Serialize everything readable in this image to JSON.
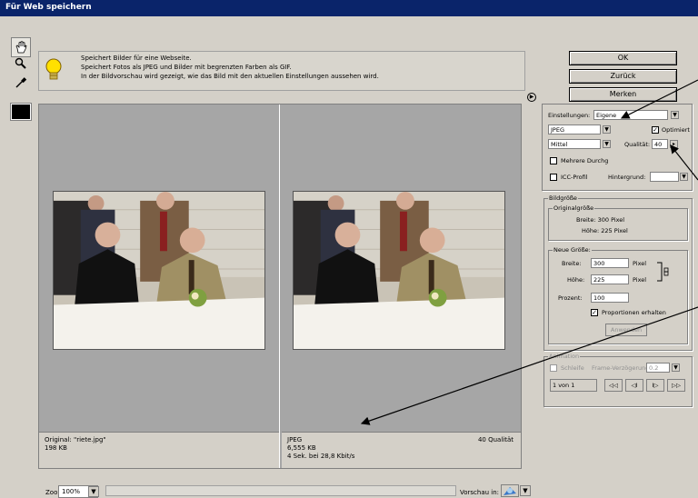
{
  "window": {
    "title": "Für Web speichern"
  },
  "info": {
    "lines": [
      "Speichert Bilder für eine Webseite.",
      "Speichert Fotos als JPEG und Bilder mit begrenzten Farben als GIF.",
      "In der Bildvorschau wird gezeigt, wie das Bild mit den aktuellen Einstellungen aussehen wird."
    ]
  },
  "preview": {
    "original": {
      "label": "Original: \"riete.jpg\"",
      "size": "198 KB"
    },
    "optimized": {
      "format": "JPEG",
      "size": "6,555 KB",
      "time": "4 Sek. bei 28,8 Kbit/s",
      "quality": "40 Qualität"
    }
  },
  "bottom": {
    "zoom_label": "Zoom:",
    "zoom_value": "100%",
    "preview_in_label": "Vorschau in:"
  },
  "buttons": {
    "ok": "OK",
    "back": "Zurück",
    "remember": "Merken"
  },
  "settings": {
    "label": "Einstellungen:",
    "preset": "Eigene",
    "format": "JPEG",
    "optimized_label": "Optimiert",
    "quality_level": "Mittel",
    "quality_label": "Qualität:",
    "quality_value": "40",
    "progressive_label": "Mehrere Durchg",
    "icc_label": "ICC-Profil",
    "matte_label": "Hintergrund:"
  },
  "image_size": {
    "title": "Bildgröße",
    "original_title": "Originalgröße",
    "orig_width": "Breite: 300 Pixel",
    "orig_height": "Höhe: 225 Pixel",
    "new_title": "Neue Größe:",
    "width_label": "Breite:",
    "width_value": "300",
    "height_label": "Höhe:",
    "height_value": "225",
    "unit": "Pixel",
    "percent_label": "Prozent:",
    "percent_value": "100",
    "constrain_label": "Proportionen erhalten",
    "apply_label": "Anwenden"
  },
  "animation": {
    "title": "Animation",
    "loop_label": "Schleife",
    "frame_delay_label": "Frame-Verzögerung:",
    "frame_delay_value": "0.2",
    "frame_counter": "1 von 1",
    "controls": [
      "◁◁",
      "◁I",
      "I▷",
      "▷▷"
    ]
  },
  "colors": {
    "accent": "#0a246a",
    "panel": "#d4d0c8",
    "preview_bg": "#a6a6a6"
  }
}
